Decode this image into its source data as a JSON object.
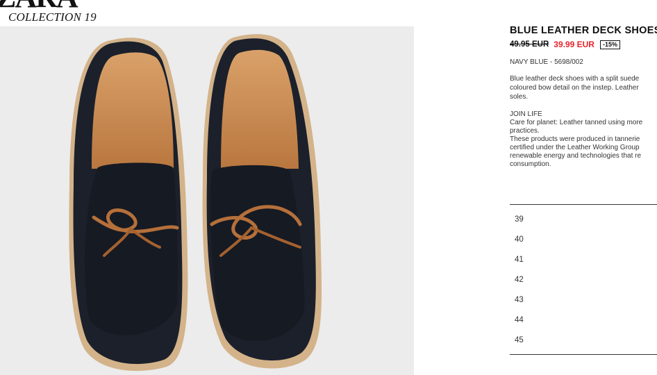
{
  "brand": {
    "logo_text": "ZARA",
    "collection": "COLLECTION 19"
  },
  "product": {
    "image_alt": "Blue leather deck shoes",
    "title": "BLUE LEATHER DECK SHOES",
    "old_price": "49.95 EUR",
    "new_price": "39.99 EUR",
    "discount": "-15%",
    "color_ref": "NAVY BLUE - 5698/002",
    "description_lines": [
      "Blue leather deck shoes with a split suede",
      "coloured bow detail on the instep. Leather",
      "soles."
    ],
    "join_life_title": "JOIN LIFE",
    "join_life_lines": [
      "Care for planet: Leather tanned using more",
      "practices.",
      "These products were produced in tannerie",
      "certified under the Leather Working Group",
      "renewable energy and technologies that re",
      "consumption."
    ]
  },
  "sizes": [
    "39",
    "40",
    "41",
    "42",
    "43",
    "44",
    "45"
  ],
  "colors": {
    "sale_red": "#e5242b",
    "suede_navy": "#1a1f2b",
    "leather_tan": "#c98a4d",
    "image_bg": "#ececec"
  }
}
